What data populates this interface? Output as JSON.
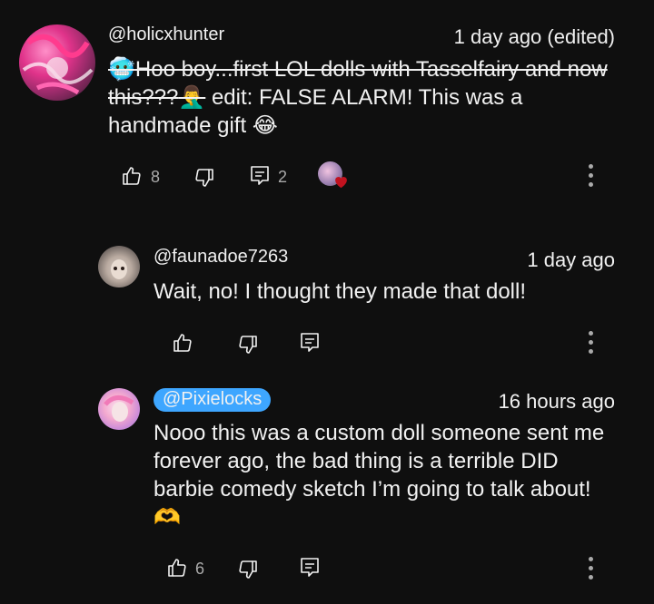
{
  "comment1": {
    "handle": "@holicxhunter",
    "time": "1 day ago (edited)",
    "text_struck_1": "Hoo boy...first LOL dolls with Tasselfairy and now",
    "text_struck_2": "this???",
    "text_edit": " edit: FALSE ALARM! This was a",
    "text_line3": "handmade gift",
    "emoji_start": "🥶",
    "emoji_facepalm": "🤦‍♂️",
    "emoji_laugh": "😂",
    "like_count": "8",
    "reply_count": "2"
  },
  "reply1": {
    "handle": "@faunadoe7263",
    "time": "1 day ago",
    "text": "Wait, no! I thought they made that doll!"
  },
  "reply2": {
    "handle": "@Pixielocks",
    "time": "16 hours ago",
    "line1": "Nooo this was a custom doll someone sent me",
    "line2": "forever ago, the bad thing is a terrible DID",
    "line3": "barbie comedy sketch I’m going to talk about!",
    "emoji_heart_hands": "🫶",
    "like_count": "6"
  },
  "colors": {
    "background": "#0f0f0f",
    "text": "#f1f1f1",
    "muted": "#aaaaaa",
    "creator_badge": "#3ea6ff",
    "heart": "#c1121f"
  },
  "icons": [
    "thumbs-up-icon",
    "thumbs-down-icon",
    "reply-icon",
    "more-vert-icon",
    "creator-heart-icon"
  ]
}
